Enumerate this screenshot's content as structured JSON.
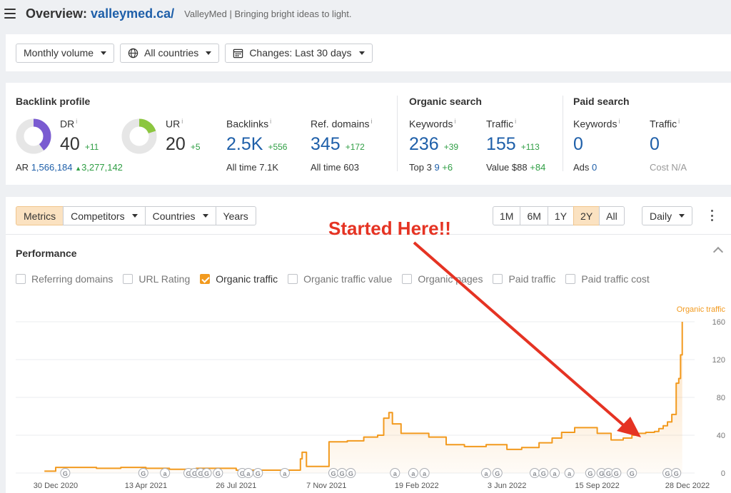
{
  "header": {
    "lead": "Overview:",
    "domain": "valleymed.ca/",
    "subtitle": "ValleyMed | Bringing bright ideas to light."
  },
  "filters": {
    "volume": "Monthly volume",
    "countries": "All countries",
    "changes": "Changes: Last 30 days"
  },
  "backlink_profile": {
    "title": "Backlink profile",
    "dr": {
      "label": "DR",
      "value": "40",
      "delta": "+11",
      "fill_fraction": 0.4,
      "color": "#7a5bd1"
    },
    "ur": {
      "label": "UR",
      "value": "20",
      "delta": "+5",
      "fill_fraction": 0.2,
      "color": "#8cc63f"
    },
    "ar": {
      "label": "AR",
      "value": "1,566,184",
      "delta": "3,277,142"
    },
    "backlinks": {
      "label": "Backlinks",
      "value": "2.5K",
      "delta": "+556",
      "foot_label": "All time",
      "foot_value": "7.1K"
    },
    "ref_domains": {
      "label": "Ref. domains",
      "value": "345",
      "delta": "+172",
      "foot_label": "All time",
      "foot_value": "603"
    }
  },
  "organic_search": {
    "title": "Organic search",
    "keywords": {
      "label": "Keywords",
      "value": "236",
      "delta": "+39",
      "foot_label": "Top 3",
      "foot_value": "9",
      "foot_delta": "+6"
    },
    "traffic": {
      "label": "Traffic",
      "value": "155",
      "delta": "+113",
      "foot_label": "Value",
      "foot_value": "$88",
      "foot_delta": "+84"
    }
  },
  "paid_search": {
    "title": "Paid search",
    "keywords": {
      "label": "Keywords",
      "value": "0",
      "foot_label": "Ads",
      "foot_value": "0"
    },
    "traffic": {
      "label": "Traffic",
      "value": "0",
      "foot_label": "Cost",
      "foot_value": "N/A"
    }
  },
  "tabs": [
    "Metrics",
    "Competitors",
    "Countries",
    "Years"
  ],
  "ranges": [
    "1M",
    "6M",
    "1Y",
    "2Y",
    "All"
  ],
  "interval": "Daily",
  "performance": {
    "title": "Performance",
    "checkboxes": [
      {
        "label": "Referring domains",
        "checked": false
      },
      {
        "label": "URL Rating",
        "checked": false
      },
      {
        "label": "Organic traffic",
        "checked": true
      },
      {
        "label": "Organic traffic value",
        "checked": false
      },
      {
        "label": "Organic pages",
        "checked": false
      },
      {
        "label": "Paid traffic",
        "checked": false
      },
      {
        "label": "Paid traffic cost",
        "checked": false
      }
    ]
  },
  "annotation": "Started Here!!",
  "colors": {
    "accent": "#f29a1f",
    "blue": "#1e5fa9",
    "positive": "#2f9e44",
    "annotation": "#e53323"
  },
  "chart_data": {
    "type": "area",
    "series": [
      {
        "name": "Organic traffic",
        "x": [
          "2020-12-17",
          "2020-12-30",
          "2021-01-15",
          "2021-02-15",
          "2021-03-15",
          "2021-04-13",
          "2021-05-10",
          "2021-06-10",
          "2021-07-01",
          "2021-07-26",
          "2021-08-20",
          "2021-09-05",
          "2021-09-20",
          "2021-10-05",
          "2021-10-08",
          "2021-10-10",
          "2021-10-15",
          "2021-11-07",
          "2021-11-10",
          "2021-12-01",
          "2021-12-20",
          "2022-01-05",
          "2022-01-12",
          "2022-01-18",
          "2022-01-22",
          "2022-02-01",
          "2022-02-19",
          "2022-03-05",
          "2022-03-25",
          "2022-04-15",
          "2022-05-10",
          "2022-06-03",
          "2022-06-20",
          "2022-07-10",
          "2022-07-25",
          "2022-08-05",
          "2022-08-20",
          "2022-09-15",
          "2022-10-01",
          "2022-10-15",
          "2022-10-25",
          "2022-11-01",
          "2022-11-10",
          "2022-11-20",
          "2022-11-25",
          "2022-11-30",
          "2022-12-05",
          "2022-12-10",
          "2022-12-15",
          "2022-12-18",
          "2022-12-20",
          "2022-12-22"
        ],
        "values": [
          2,
          6,
          6,
          5,
          6,
          5,
          4,
          5,
          5,
          3,
          3,
          3,
          3,
          3,
          15,
          22,
          7,
          7,
          33,
          34,
          38,
          40,
          58,
          64,
          52,
          42,
          42,
          38,
          30,
          28,
          30,
          25,
          27,
          32,
          37,
          43,
          48,
          42,
          35,
          37,
          40,
          42,
          43,
          44,
          47,
          50,
          54,
          62,
          95,
          100,
          125,
          160
        ]
      }
    ],
    "x_ticks": [
      "30 Dec 2020",
      "13 Apr 2021",
      "26 Jul 2021",
      "7 Nov 2021",
      "19 Feb 2022",
      "3 Jun 2022",
      "15 Sep 2022",
      "28 Dec 2022"
    ],
    "x_tick_dates": [
      "2020-12-30",
      "2021-04-13",
      "2021-07-26",
      "2021-11-07",
      "2022-02-19",
      "2022-06-03",
      "2022-09-15",
      "2022-12-28"
    ],
    "y_ticks": [
      0,
      40,
      80,
      120,
      160
    ],
    "ylim": [
      0,
      160
    ],
    "y_axis_side": "right",
    "legend_label": "Organic traffic",
    "grid": true,
    "markers": [
      {
        "x": "2021-01-10",
        "type": "G"
      },
      {
        "x": "2021-04-10",
        "type": "G"
      },
      {
        "x": "2021-05-05",
        "type": "a"
      },
      {
        "x": "2021-06-01",
        "type": "G"
      },
      {
        "x": "2021-06-08",
        "type": "G"
      },
      {
        "x": "2021-06-15",
        "type": "G"
      },
      {
        "x": "2021-06-22",
        "type": "G"
      },
      {
        "x": "2021-07-05",
        "type": "G"
      },
      {
        "x": "2021-08-02",
        "type": "G"
      },
      {
        "x": "2021-08-09",
        "type": "a"
      },
      {
        "x": "2021-08-20",
        "type": "G"
      },
      {
        "x": "2021-09-20",
        "type": "a"
      },
      {
        "x": "2021-11-15",
        "type": "G"
      },
      {
        "x": "2021-11-25",
        "type": "G"
      },
      {
        "x": "2021-12-05",
        "type": "G"
      },
      {
        "x": "2022-01-25",
        "type": "a"
      },
      {
        "x": "2022-02-15",
        "type": "a"
      },
      {
        "x": "2022-02-28",
        "type": "a"
      },
      {
        "x": "2022-05-10",
        "type": "a"
      },
      {
        "x": "2022-05-23",
        "type": "G"
      },
      {
        "x": "2022-07-05",
        "type": "a"
      },
      {
        "x": "2022-07-15",
        "type": "G"
      },
      {
        "x": "2022-07-28",
        "type": "a"
      },
      {
        "x": "2022-08-14",
        "type": "a"
      },
      {
        "x": "2022-09-07",
        "type": "G"
      },
      {
        "x": "2022-09-20",
        "type": "G"
      },
      {
        "x": "2022-09-28",
        "type": "G"
      },
      {
        "x": "2022-10-07",
        "type": "G"
      },
      {
        "x": "2022-10-25",
        "type": "G"
      },
      {
        "x": "2022-12-05",
        "type": "G"
      },
      {
        "x": "2022-12-15",
        "type": "G"
      }
    ]
  }
}
